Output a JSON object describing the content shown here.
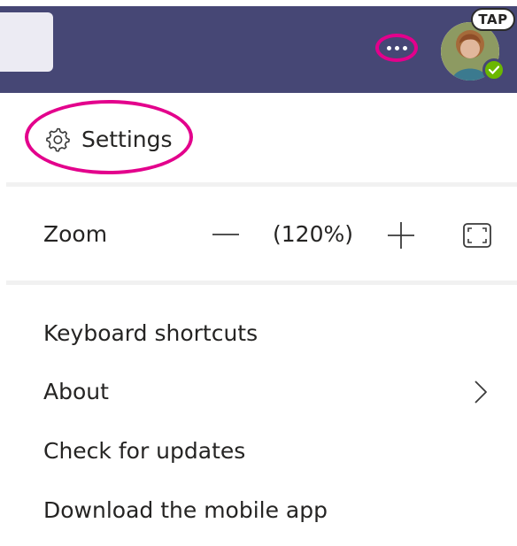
{
  "header": {
    "more_icon": "more-horizontal-icon",
    "tap_label": "TAP",
    "status": "available"
  },
  "settings": {
    "label": "Settings",
    "icon": "gear-icon"
  },
  "zoom": {
    "label": "Zoom",
    "value": "(120%)",
    "minus_icon": "minus-icon",
    "plus_icon": "plus-icon",
    "fullscreen_icon": "fullscreen-icon"
  },
  "menu": {
    "items": [
      {
        "label": "Keyboard shortcuts"
      },
      {
        "label": "About",
        "has_submenu": true
      },
      {
        "label": "Check for updates"
      },
      {
        "label": "Download the mobile app"
      }
    ]
  },
  "colors": {
    "header": "#464775",
    "highlight": "#e3008c",
    "status": "#6bb700"
  }
}
